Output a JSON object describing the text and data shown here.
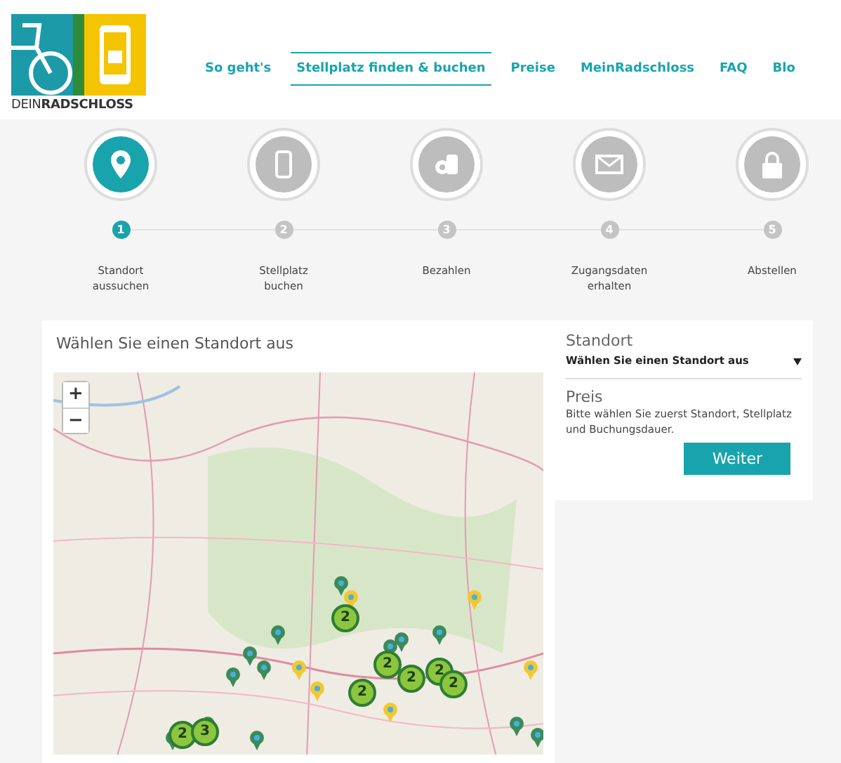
{
  "logo": {
    "prefix": "DEIN",
    "brand": "RADSCHLOSS"
  },
  "nav": [
    {
      "label": "So geht's",
      "selected": false
    },
    {
      "label": "Stellplatz finden & buchen",
      "selected": true
    },
    {
      "label": "Preise",
      "selected": false
    },
    {
      "label": "MeinRadschloss",
      "selected": false
    },
    {
      "label": "FAQ",
      "selected": false
    },
    {
      "label": "Blo",
      "selected": false
    }
  ],
  "steps": [
    {
      "number": "1",
      "label": "Standort aussuchen",
      "selected": true
    },
    {
      "number": "2",
      "label": "Stellplatz buchen",
      "selected": false
    },
    {
      "number": "3",
      "label": "Bezahlen",
      "selected": false
    },
    {
      "number": "4",
      "label": "Zugangsdaten erhalten",
      "selected": false
    },
    {
      "number": "5",
      "label": "Abstellen",
      "selected": false
    }
  ],
  "map_panel": {
    "title": "Wählen Sie einen Standort aus",
    "zoom_in": "+",
    "zoom_out": "−",
    "clusters": [
      "2",
      "2",
      "2",
      "2",
      "2",
      "2",
      "2",
      "3"
    ]
  },
  "booking": {
    "location_label": "Standort",
    "location_value": "Wählen Sie einen Standort aus",
    "price_label": "Preis",
    "price_hint": "Bitte wählen Sie zuerst Standort, Stellplatz und Buchungsdauer.",
    "button": "Weiter"
  }
}
